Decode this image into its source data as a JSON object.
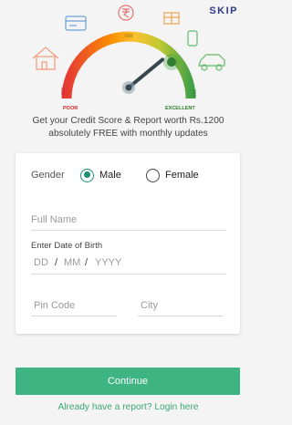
{
  "header": {
    "skip_label": "SKIP"
  },
  "gauge": {
    "label_poor": "POOR",
    "label_excellent": "EXCELLENT",
    "tick_300": "300",
    "tick_600": "600",
    "tick_900": "900",
    "level_fraction": 0.78,
    "colors": {
      "low": "#e53935",
      "mid": "#fbc02d",
      "high": "#43a047",
      "needle": "#37474f"
    }
  },
  "tagline": {
    "line1": "Get your Credit Score & Report worth Rs.1200",
    "line2": "absolutely FREE with monthly updates"
  },
  "form": {
    "gender_label": "Gender",
    "gender_options": [
      {
        "label": "Male",
        "selected": true
      },
      {
        "label": "Female",
        "selected": false
      }
    ],
    "full_name_placeholder": "Full Name",
    "dob_label": "Enter Date of Birth",
    "dob_dd": "DD",
    "dob_mm": "MM",
    "dob_yyyy": "YYYY",
    "dob_sep": "/",
    "pin_placeholder": "Pin Code",
    "city_placeholder": "City"
  },
  "actions": {
    "continue_label": "Continue",
    "login_text": "Already have a report? Login here",
    "accent": "#3eb482"
  }
}
